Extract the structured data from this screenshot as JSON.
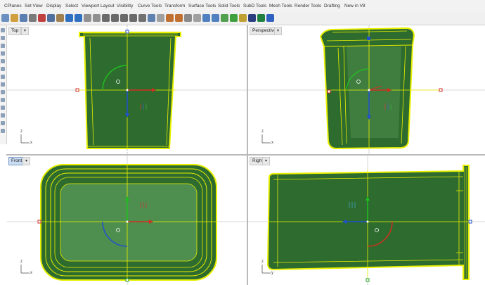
{
  "menu_tabs": [
    "CPlanes",
    "Set View",
    "Display",
    "Select",
    "Viewport Layout",
    "Visibility",
    "Curve Tools",
    "Transform",
    "Surface Tools",
    "Solid Tools",
    "SubD Tools",
    "Mesh Tools",
    "Render Tools",
    "Drafting",
    "New in V8"
  ],
  "toolbar_icons": [
    "new-file",
    "open-file",
    "save",
    "print",
    "cut",
    "copy",
    "paste",
    "undo",
    "redo",
    "pan",
    "rotate-view",
    "zoom",
    "zoom-window",
    "zoom-extents",
    "zoom-selected",
    "four-viewports",
    "properties",
    "grid-snap",
    "show-objects",
    "hide-objects",
    "lock-objects",
    "layer",
    "point-on",
    "curve-on",
    "surface-on",
    "material",
    "render",
    "sphere-render",
    "environment",
    "help"
  ],
  "viewports": {
    "top": {
      "title": "Top",
      "dropdown": "▾",
      "axis_x": "x",
      "axis_y": "z"
    },
    "perspective": {
      "title": "Perspective",
      "dropdown": "▾",
      "axis_x": "x",
      "axis_y": "z"
    },
    "front": {
      "title": "Front",
      "dropdown": "▾",
      "axis_x": "x",
      "axis_y": "z"
    },
    "right": {
      "title": "Right",
      "dropdown": "▾",
      "axis_x": "y",
      "axis_y": "z"
    }
  },
  "colors": {
    "object_fill": "#2e6b2e",
    "selection": "#e8f000",
    "x_axis": "#d03020",
    "y_axis": "#20a020",
    "z_axis": "#2050d0",
    "active_title": "#c9dcf2"
  }
}
